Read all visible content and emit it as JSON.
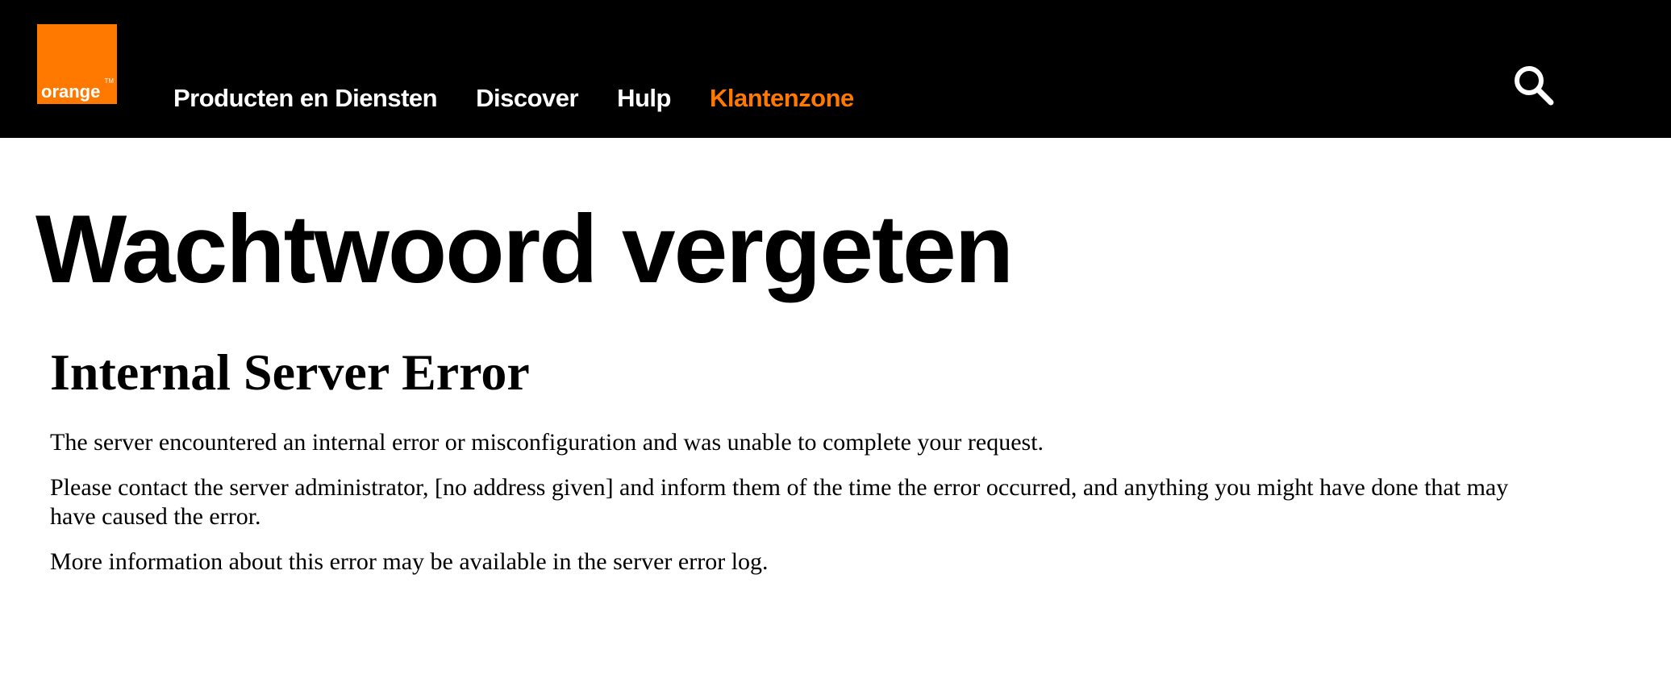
{
  "header": {
    "logo": {
      "text": "orange",
      "tm": "TM",
      "color": "#ff7900"
    },
    "nav": [
      {
        "label": "Producten en Diensten",
        "active": false
      },
      {
        "label": "Discover",
        "active": false
      },
      {
        "label": "Hulp",
        "active": false
      },
      {
        "label": "Klantenzone",
        "active": true
      }
    ],
    "search_icon": "search-icon"
  },
  "main": {
    "title": "Wachtwoord vergeten",
    "error": {
      "heading": "Internal Server Error",
      "paragraphs": [
        "The server encountered an internal error or misconfiguration and was unable to complete your request.",
        "Please contact the server administrator, [no address given] and inform them of the time the error occurred, and anything you might have done that may have caused the error.",
        "More information about this error may be available in the server error log."
      ]
    }
  },
  "colors": {
    "header_bg": "#000000",
    "accent": "#ff7900",
    "text": "#000000"
  }
}
